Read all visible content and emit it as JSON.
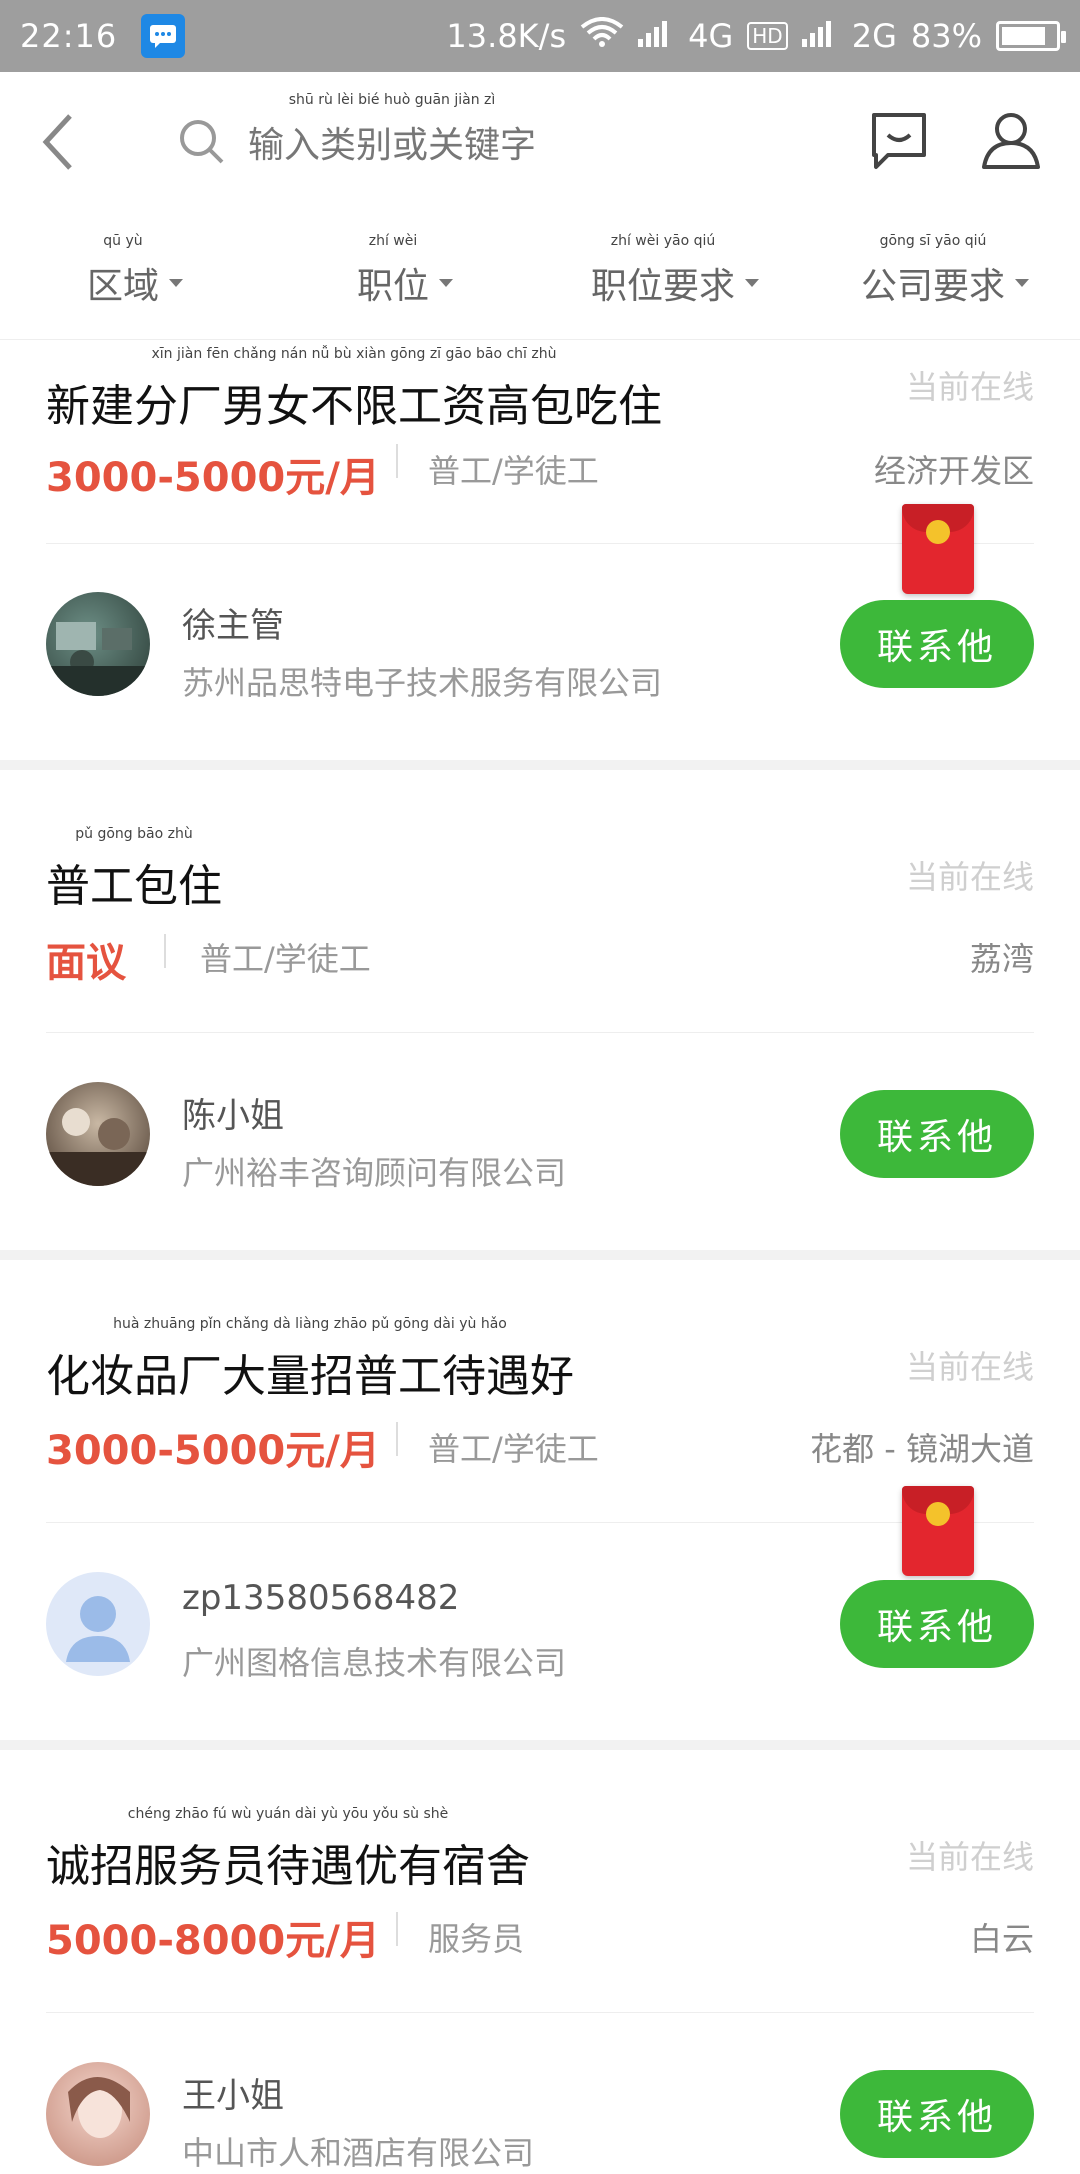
{
  "status_bar": {
    "time": "22:16",
    "speed": "13.8K/s",
    "network1": "4G",
    "hd": "HD",
    "network2": "2G",
    "battery": "83%",
    "battery_level": 0.83
  },
  "header": {
    "search_placeholder": "输入类别或关键字",
    "search_pinyin": "shū rù lèi bié huò guān jiàn zì"
  },
  "filters": [
    {
      "label": "区域",
      "pinyin": "qū yù"
    },
    {
      "label": "职位",
      "pinyin": "zhí wèi"
    },
    {
      "label": "职位要求",
      "pinyin": "zhí wèi yāo qiú"
    },
    {
      "label": "公司要求",
      "pinyin": "gōng sī yāo qiú"
    }
  ],
  "jobs": [
    {
      "title": "新建分厂男女不限工资高包吃住",
      "title_pinyin": "xīn jiàn fēn chǎng nán nǚ bù xiàn gōng zī gāo bāo chī zhù",
      "online": "当前在线",
      "salary": "3000-5000元/月",
      "category": "普工/学徒工",
      "location": "经济开发区",
      "contact_name": "徐主管",
      "company": "苏州品思特电子技术服务有限公司",
      "contact_button": "联系他",
      "has_redpack": true
    },
    {
      "title": "普工包住",
      "title_pinyin": "pǔ gōng bāo zhù",
      "online": "当前在线",
      "salary": "面议",
      "category": "普工/学徒工",
      "location": "荔湾",
      "contact_name": "陈小姐",
      "company": "广州裕丰咨询顾问有限公司",
      "contact_button": "联系他",
      "has_redpack": false
    },
    {
      "title": "化妆品厂大量招普工待遇好",
      "title_pinyin": "huà zhuāng pǐn chǎng dà liàng zhāo pǔ gōng dài yù hǎo",
      "online": "当前在线",
      "salary": "3000-5000元/月",
      "category": "普工/学徒工",
      "location": "花都 - 镜湖大道",
      "contact_name": "zp13580568482",
      "company": "广州图格信息技术有限公司",
      "contact_button": "联系他",
      "has_redpack": true
    },
    {
      "title": "诚招服务员待遇优有宿舍",
      "title_pinyin": "chéng zhāo fú wù yuán dài yù yōu yǒu sù shè",
      "online": "当前在线",
      "salary": "5000-8000元/月",
      "category": "服务员",
      "location": "白云",
      "contact_name": "王小姐",
      "company": "中山市人和酒店有限公司",
      "contact_button": "联系他",
      "has_redpack": false
    }
  ],
  "colors": {
    "accent_green": "#3db83a",
    "salary_red": "#e5533f",
    "status_bar_gray": "#9e9e9e"
  }
}
